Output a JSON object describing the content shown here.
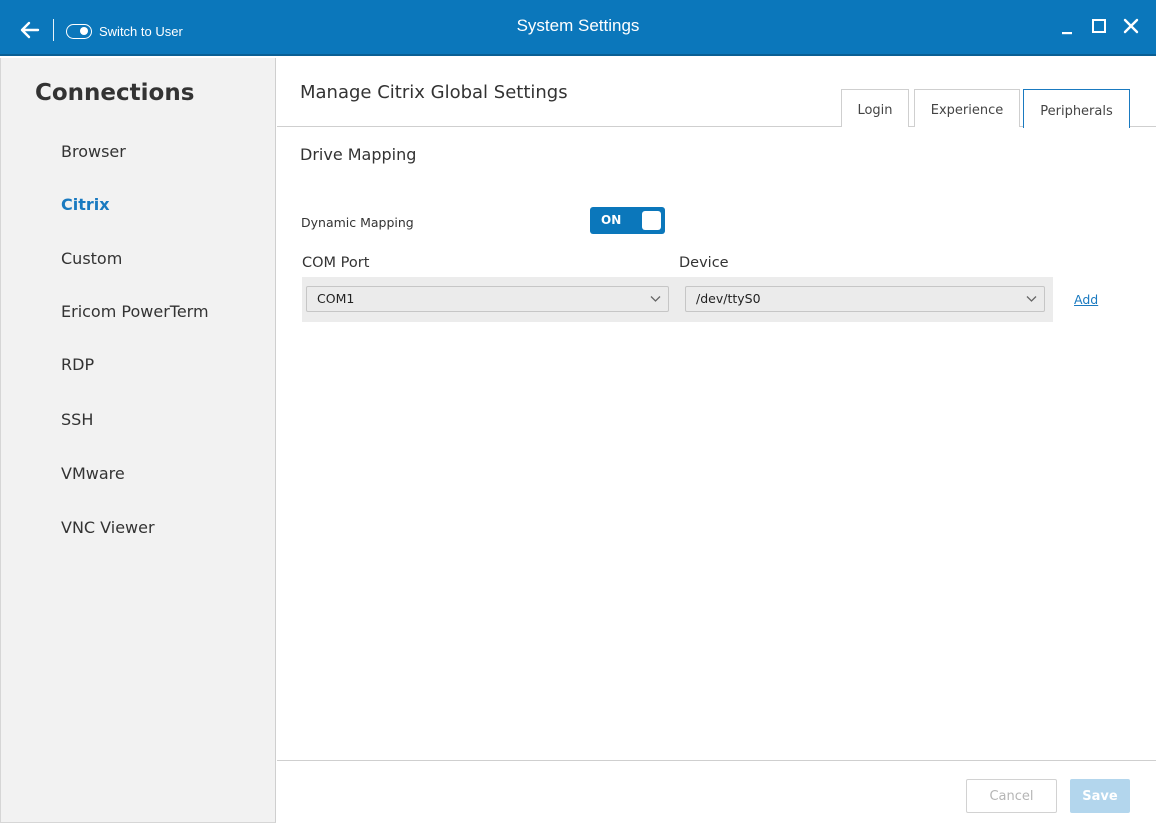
{
  "titlebar": {
    "switch_label": "Switch to User",
    "title": "System Settings",
    "color": "#0b77bb"
  },
  "sidebar": {
    "heading": "Connections",
    "items": [
      {
        "label": "Browser"
      },
      {
        "label": "Citrix",
        "active": true
      },
      {
        "label": "Custom"
      },
      {
        "label": "Ericom PowerTerm"
      },
      {
        "label": "RDP"
      },
      {
        "label": "SSH"
      },
      {
        "label": "VMware"
      },
      {
        "label": "VNC Viewer"
      }
    ]
  },
  "main": {
    "title": "Manage Citrix Global Settings",
    "tabs": [
      {
        "label": "Login"
      },
      {
        "label": "Experience"
      },
      {
        "label": "Peripherals",
        "active": true
      }
    ],
    "section_title": "Drive Mapping",
    "dynamic_mapping": {
      "label": "Dynamic Mapping",
      "state": "ON"
    },
    "columns": {
      "com_port": "COM Port",
      "device": "Device"
    },
    "row": {
      "com_port": "COM1",
      "device": "/dev/ttyS0"
    },
    "add_label": "Add",
    "cancel_label": "Cancel",
    "save_label": "Save"
  },
  "icons": {
    "back": "arrow-left-icon",
    "minimize": "minimize-icon",
    "maximize": "maximize-icon",
    "close": "close-icon",
    "dropdown": "chevron-down-icon"
  },
  "colors": {
    "accent": "#1a7ac0",
    "save_disabled": "#b3d6ed"
  }
}
